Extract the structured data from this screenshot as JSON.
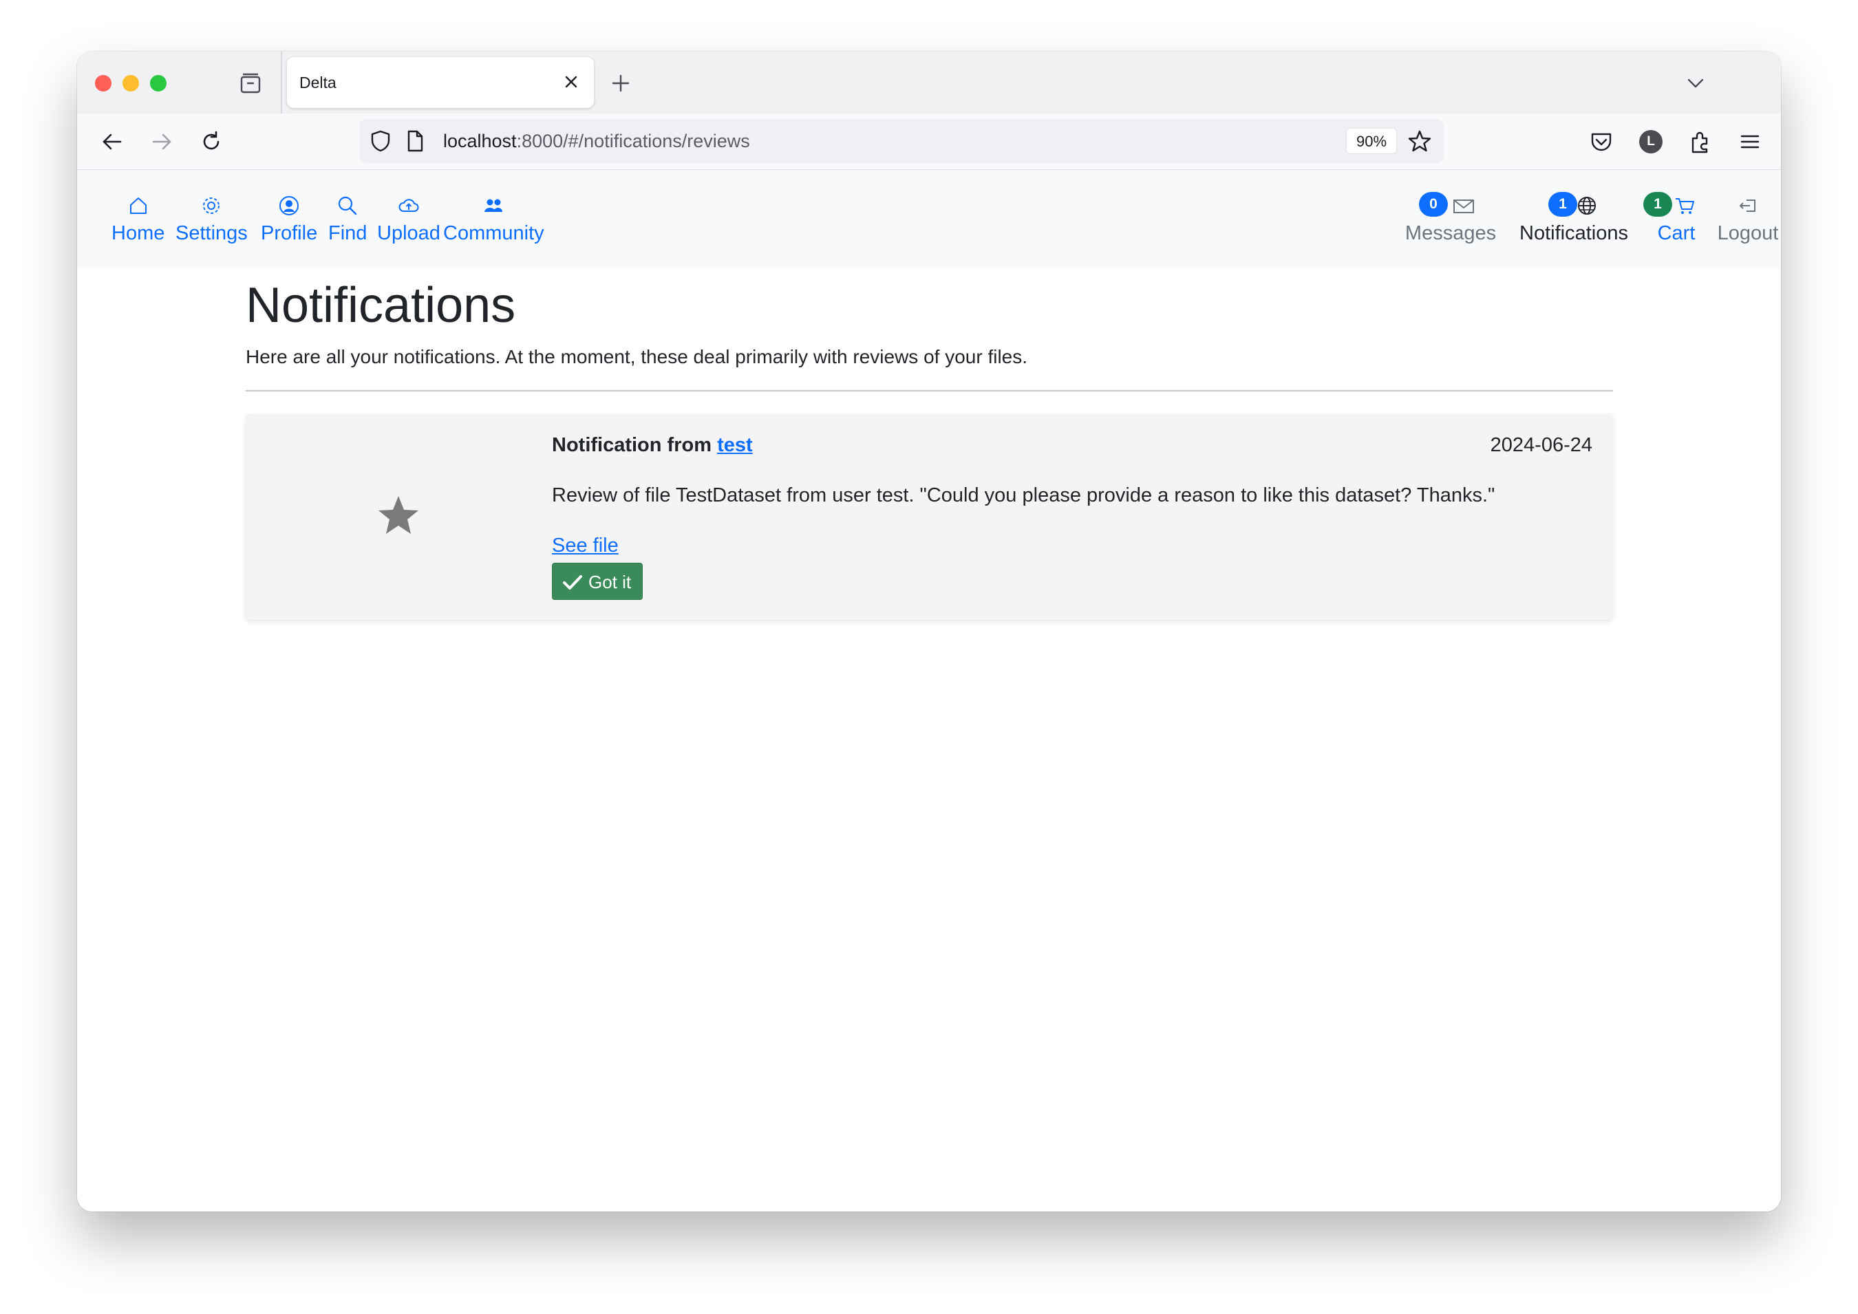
{
  "browser": {
    "tab_title": "Delta",
    "url_host": "localhost",
    "url_rest": ":8000/#/notifications/reviews",
    "zoom": "90%",
    "account_initial": "L"
  },
  "site_nav": {
    "left": [
      {
        "label": "Home",
        "icon": "house-icon"
      },
      {
        "label": "Settings",
        "icon": "gear-icon"
      },
      {
        "label": "Profile",
        "icon": "person-circle-icon"
      },
      {
        "label": "Find",
        "icon": "search-icon"
      },
      {
        "label": "Upload",
        "icon": "cloud-upload-icon"
      },
      {
        "label": "Community",
        "icon": "people-icon"
      }
    ],
    "right": [
      {
        "label": "Messages",
        "icon": "envelope-icon",
        "badge": "0"
      },
      {
        "label": "Notifications",
        "icon": "globe-icon",
        "badge": "1"
      },
      {
        "label": "Cart",
        "icon": "cart-icon",
        "badge": "1"
      },
      {
        "label": "Logout",
        "icon": "logout-icon"
      }
    ]
  },
  "main": {
    "title": "Notifications",
    "lead": "Here are all your notifications. At the moment, these deal primarily with reviews of your files."
  },
  "notifications": [
    {
      "heading_prefix": "Notification from",
      "from_user": "test",
      "date": "2024-06-24",
      "text": "Review of file TestDataset from user test. \"Could you please provide a reason to like this dataset? Thanks.\"",
      "link_label": "See file",
      "button_label": "Got it",
      "icon": "star-icon"
    }
  ],
  "colors": {
    "link": "#0d6efd",
    "badge_primary": "#0d6efd",
    "badge_success": "#198754",
    "button_success": "#3a8a5a",
    "nav_muted": "#6c757d"
  }
}
